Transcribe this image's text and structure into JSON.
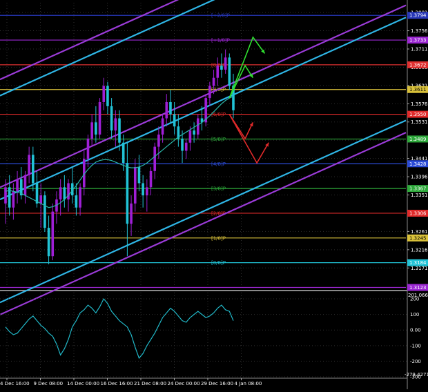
{
  "chart_data": [
    {
      "type": "candlestick",
      "panel": "price",
      "colors": {
        "background": "#000000",
        "bull": "#9f1fd6",
        "bear": "#21c3d6",
        "ma": "#2ab5a8",
        "grid": "#2f2f2f"
      },
      "y_ticks": [
        "1.3801",
        "1.3756",
        "1.3711",
        "1.3666",
        "1.3621",
        "1.3576",
        "1.3531",
        "1.3486",
        "1.3441",
        "1.3396",
        "1.3351",
        "1.3306",
        "1.3261",
        "1.3216",
        "1.3171"
      ],
      "ylim": [
        1.3117,
        1.3825
      ],
      "x_ticks": [
        "4 Dec 16:00",
        "9 Dec 08:00",
        "14 Dec 00:00",
        "16 Dec 16:00",
        "21 Dec 08:00",
        "24 Dec 00:00",
        "29 Dec 16:00",
        "4 Jan 08:00"
      ],
      "murrey_levels": [
        {
          "label": "[+2/8]P",
          "price": 1.3794,
          "color": "#2737b8",
          "tag": "1.3794",
          "tag_color": "#1c2bb0"
        },
        {
          "label": "[+1/8]P",
          "price": 1.3733,
          "color": "#9b27d2",
          "tag": "1.3733",
          "tag_color": "#8e22c9"
        },
        {
          "label": "[8/8]P",
          "price": 1.3672,
          "color": "#e03030",
          "tag": "1.3672",
          "tag_color": "#d12727"
        },
        {
          "label": "[7/8]P",
          "price": 1.3611,
          "color": "#d9c13a",
          "tag": "1.3611",
          "tag_color": "#000000"
        },
        {
          "label": "[6/8]P",
          "price": 1.355,
          "color": "#e02a2a",
          "tag": "1.3550",
          "tag_color": "#d12727"
        },
        {
          "label": "[5/8]P",
          "price": 1.3489,
          "color": "#2da83a",
          "tag": "1.3489",
          "tag_color": "#1b7a25"
        },
        {
          "label": "[4/8]P",
          "price": 1.3428,
          "color": "#2b4bd6",
          "tag": "1.3428",
          "tag_color": "#1c35c0"
        },
        {
          "label": "[3/8]P",
          "price": 1.3367,
          "color": "#2da83a",
          "tag": "1.3367",
          "tag_color": "#1b7a25"
        },
        {
          "label": "[2/8]P",
          "price": 1.3306,
          "color": "#e02a2a",
          "tag": "1.3306",
          "tag_color": "#d12727"
        },
        {
          "label": "[1/8]P",
          "price": 1.3245,
          "color": "#d9c13a",
          "tag": "1.3245",
          "tag_color": "#000000"
        },
        {
          "label": "[0/8]P",
          "price": 1.3184,
          "color": "#21c3d6",
          "tag": "1.3184",
          "tag_color": "#1a9fb0"
        },
        {
          "label": "",
          "price": 1.3123,
          "color": "#9b27d2",
          "tag": "1.3123",
          "tag_color": "#8e22c9"
        }
      ],
      "current_price": {
        "value": 1.3672,
        "tag": "1.3672"
      },
      "candles": [
        [
          1.333,
          1.339,
          1.328,
          1.337
        ],
        [
          1.337,
          1.34,
          1.33,
          1.332
        ],
        [
          1.332,
          1.338,
          1.329,
          1.336
        ],
        [
          1.336,
          1.341,
          1.333,
          1.339
        ],
        [
          1.339,
          1.342,
          1.334,
          1.335
        ],
        [
          1.335,
          1.341,
          1.333,
          1.34
        ],
        [
          1.34,
          1.347,
          1.338,
          1.345
        ],
        [
          1.345,
          1.347,
          1.336,
          1.338
        ],
        [
          1.338,
          1.341,
          1.332,
          1.333
        ],
        [
          1.333,
          1.338,
          1.327,
          1.335
        ],
        [
          1.335,
          1.336,
          1.326,
          1.327
        ],
        [
          1.327,
          1.33,
          1.318,
          1.32
        ],
        [
          1.32,
          1.333,
          1.319,
          1.331
        ],
        [
          1.331,
          1.336,
          1.328,
          1.334
        ],
        [
          1.334,
          1.339,
          1.33,
          1.337
        ],
        [
          1.337,
          1.34,
          1.332,
          1.334
        ],
        [
          1.334,
          1.339,
          1.331,
          1.338
        ],
        [
          1.338,
          1.342,
          1.333,
          1.335
        ],
        [
          1.335,
          1.338,
          1.33,
          1.332
        ],
        [
          1.332,
          1.338,
          1.33,
          1.337
        ],
        [
          1.337,
          1.346,
          1.335,
          1.344
        ],
        [
          1.344,
          1.35,
          1.342,
          1.349
        ],
        [
          1.349,
          1.355,
          1.347,
          1.353
        ],
        [
          1.353,
          1.357,
          1.348,
          1.35
        ],
        [
          1.35,
          1.359,
          1.349,
          1.358
        ],
        [
          1.358,
          1.364,
          1.356,
          1.362
        ],
        [
          1.362,
          1.363,
          1.355,
          1.357
        ],
        [
          1.357,
          1.359,
          1.349,
          1.351
        ],
        [
          1.351,
          1.356,
          1.347,
          1.354
        ],
        [
          1.354,
          1.356,
          1.346,
          1.348
        ],
        [
          1.348,
          1.35,
          1.341,
          1.343
        ],
        [
          1.343,
          1.348,
          1.32,
          1.328
        ],
        [
          1.328,
          1.335,
          1.325,
          1.333
        ],
        [
          1.333,
          1.344,
          1.331,
          1.342
        ],
        [
          1.342,
          1.345,
          1.336,
          1.338
        ],
        [
          1.338,
          1.34,
          1.332,
          1.335
        ],
        [
          1.335,
          1.339,
          1.331,
          1.337
        ],
        [
          1.337,
          1.342,
          1.335,
          1.341
        ],
        [
          1.341,
          1.348,
          1.339,
          1.347
        ],
        [
          1.347,
          1.352,
          1.344,
          1.35
        ],
        [
          1.35,
          1.355,
          1.348,
          1.354
        ],
        [
          1.354,
          1.36,
          1.352,
          1.358
        ],
        [
          1.358,
          1.361,
          1.353,
          1.355
        ],
        [
          1.355,
          1.358,
          1.35,
          1.352
        ],
        [
          1.352,
          1.355,
          1.347,
          1.349
        ],
        [
          1.349,
          1.351,
          1.343,
          1.346
        ],
        [
          1.346,
          1.349,
          1.344,
          1.348
        ],
        [
          1.348,
          1.352,
          1.346,
          1.351
        ],
        [
          1.351,
          1.353,
          1.348,
          1.35
        ],
        [
          1.35,
          1.355,
          1.349,
          1.354
        ],
        [
          1.354,
          1.357,
          1.351,
          1.353
        ],
        [
          1.353,
          1.36,
          1.352,
          1.359
        ],
        [
          1.359,
          1.363,
          1.357,
          1.362
        ],
        [
          1.362,
          1.366,
          1.36,
          1.364
        ],
        [
          1.364,
          1.369,
          1.362,
          1.367
        ],
        [
          1.367,
          1.37,
          1.364,
          1.366
        ],
        [
          1.366,
          1.371,
          1.365,
          1.369
        ],
        [
          1.369,
          1.37,
          1.361,
          1.362
        ],
        [
          1.362,
          1.365,
          1.354,
          1.356
        ]
      ],
      "ma_values": [
        1.336,
        1.3362,
        1.336,
        1.3358,
        1.3355,
        1.335,
        1.3345,
        1.334,
        1.3335,
        1.333,
        1.3325,
        1.332,
        1.3322,
        1.3326,
        1.3332,
        1.334,
        1.335,
        1.3362,
        1.3374,
        1.3388,
        1.3402,
        1.3414,
        1.3424,
        1.3432,
        1.3436,
        1.3438,
        1.3438,
        1.3436,
        1.3432,
        1.3428,
        1.3424,
        1.342,
        1.3418,
        1.3418,
        1.342,
        1.3424,
        1.343,
        1.3438,
        1.3446,
        1.3454,
        1.3462,
        1.347,
        1.3478,
        1.3486,
        1.3494,
        1.35,
        1.3506,
        1.3512,
        1.3518,
        1.3524,
        1.353,
        1.3538,
        1.3546,
        1.3556,
        1.3566,
        1.3576,
        1.3584,
        1.359,
        1.3594
      ],
      "channels": {
        "cyan": [
          {
            "p1": [
              0,
              1.3346
            ],
            "p2": [
              58,
              1.3598
            ]
          },
          {
            "p1": [
              0,
              1.3092
            ],
            "p2": [
              58,
              1.3344
            ]
          },
          {
            "p1": [
              0,
              1.3602
            ],
            "p2": [
              58,
              1.3854
            ]
          }
        ],
        "purple": [
          {
            "p1": [
              0,
              1.3376
            ],
            "p2": [
              58,
              1.3628
            ]
          },
          {
            "p1": [
              0,
              1.3062
            ],
            "p2": [
              58,
              1.3314
            ]
          },
          {
            "p1": [
              0,
              1.3642
            ],
            "p2": [
              58,
              1.3894
            ]
          }
        ]
      },
      "scenario_arrows": [
        {
          "color": "#2fe02f",
          "points": [
            [
              57,
              1.359
            ],
            [
              61,
              1.367
            ],
            [
              63,
              1.364
            ]
          ]
        },
        {
          "color": "#2fe02f",
          "points": [
            [
              57,
              1.359
            ],
            [
              63,
              1.374
            ],
            [
              66,
              1.37
            ]
          ]
        },
        {
          "color": "#e02a2a",
          "points": [
            [
              57,
              1.355
            ],
            [
              61,
              1.349
            ],
            [
              63,
              1.353
            ]
          ]
        },
        {
          "color": "#e02a2a",
          "points": [
            [
              57,
              1.355
            ],
            [
              64,
              1.343
            ],
            [
              67,
              1.348
            ]
          ]
        }
      ]
    },
    {
      "type": "line",
      "panel": "indicator",
      "top_value": "201.0664",
      "bottom_value": "-279.4271",
      "y_ticks": [
        "200",
        "100",
        "0.00",
        "-100",
        "-200",
        "-300"
      ],
      "ylim": [
        -300,
        240
      ],
      "color": "#21b8c8",
      "values": [
        20,
        -10,
        -30,
        -20,
        10,
        40,
        70,
        90,
        60,
        30,
        10,
        -20,
        -40,
        -90,
        -160,
        -120,
        -60,
        20,
        60,
        110,
        130,
        160,
        140,
        110,
        150,
        200,
        170,
        120,
        90,
        60,
        40,
        20,
        -30,
        -110,
        -180,
        -150,
        -100,
        -60,
        -20,
        30,
        80,
        110,
        140,
        120,
        90,
        60,
        50,
        80,
        100,
        120,
        100,
        80,
        90,
        110,
        140,
        160,
        130,
        120,
        60
      ]
    }
  ]
}
